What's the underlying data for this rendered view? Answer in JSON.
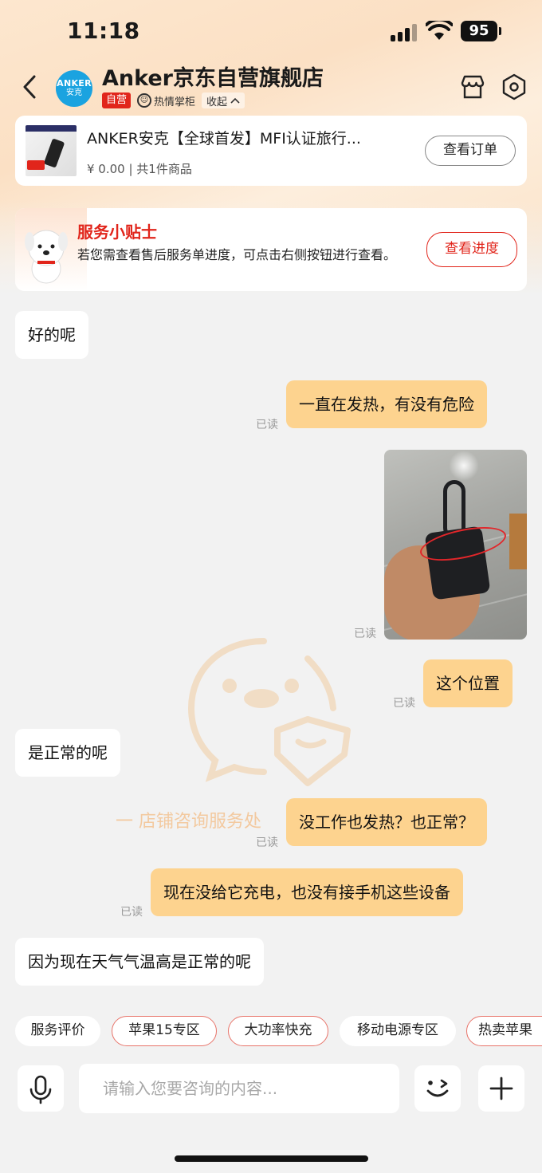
{
  "status_bar": {
    "time": "11:18",
    "battery": "95"
  },
  "header": {
    "store_name": "Anker京东自营旗舰店",
    "logo_line1": "ANKER",
    "logo_line2": "安克",
    "tag_self": "自营",
    "tag_passion": "热情掌柜",
    "collapse": "收起"
  },
  "order": {
    "title": "ANKER安克【全球首发】MFI认证旅行...",
    "subtitle": "¥ 0.00 | 共1件商品",
    "button": "查看订单"
  },
  "tip": {
    "title": "服务小贴士",
    "text": "若您需查看售后服务单进度，可点击右侧按钮进行查看。",
    "button": "查看进度"
  },
  "watermark_text": "一 店铺咨询服务处",
  "messages": [
    {
      "side": "left",
      "text": "好的呢"
    },
    {
      "side": "right",
      "text": "一直在发热，有没有危险",
      "status": "已读"
    },
    {
      "side": "right",
      "type": "image",
      "status": "已读"
    },
    {
      "side": "right",
      "text": "这个位置",
      "status": "已读"
    },
    {
      "side": "left",
      "text": "是正常的呢"
    },
    {
      "side": "right",
      "text": "没工作也发热？也正常？",
      "status": "已读"
    },
    {
      "side": "right",
      "text": "现在没给它充电，也没有接手机这些设备",
      "status": "已读"
    },
    {
      "side": "left",
      "text": "因为现在天气气温高是正常的呢"
    }
  ],
  "quick_chips": [
    {
      "label": "服务评价",
      "style": "plain"
    },
    {
      "label": "苹果15专区",
      "style": "hot"
    },
    {
      "label": "大功率快充",
      "style": "hot"
    },
    {
      "label": "移动电源专区",
      "style": "plain"
    },
    {
      "label": "热卖苹果",
      "style": "hot"
    }
  ],
  "input": {
    "placeholder": "请输入您要咨询的内容..."
  },
  "icons": {
    "back": "chevron-left-icon",
    "store": "store-icon",
    "settings": "hexagon-settings-icon",
    "mic": "microphone-icon",
    "emoji": "emoji-icon",
    "plus": "plus-icon"
  },
  "colors": {
    "accent_red": "#e1251b",
    "bubble_self": "#fdd38f",
    "logo_blue": "#1aa3e0"
  }
}
